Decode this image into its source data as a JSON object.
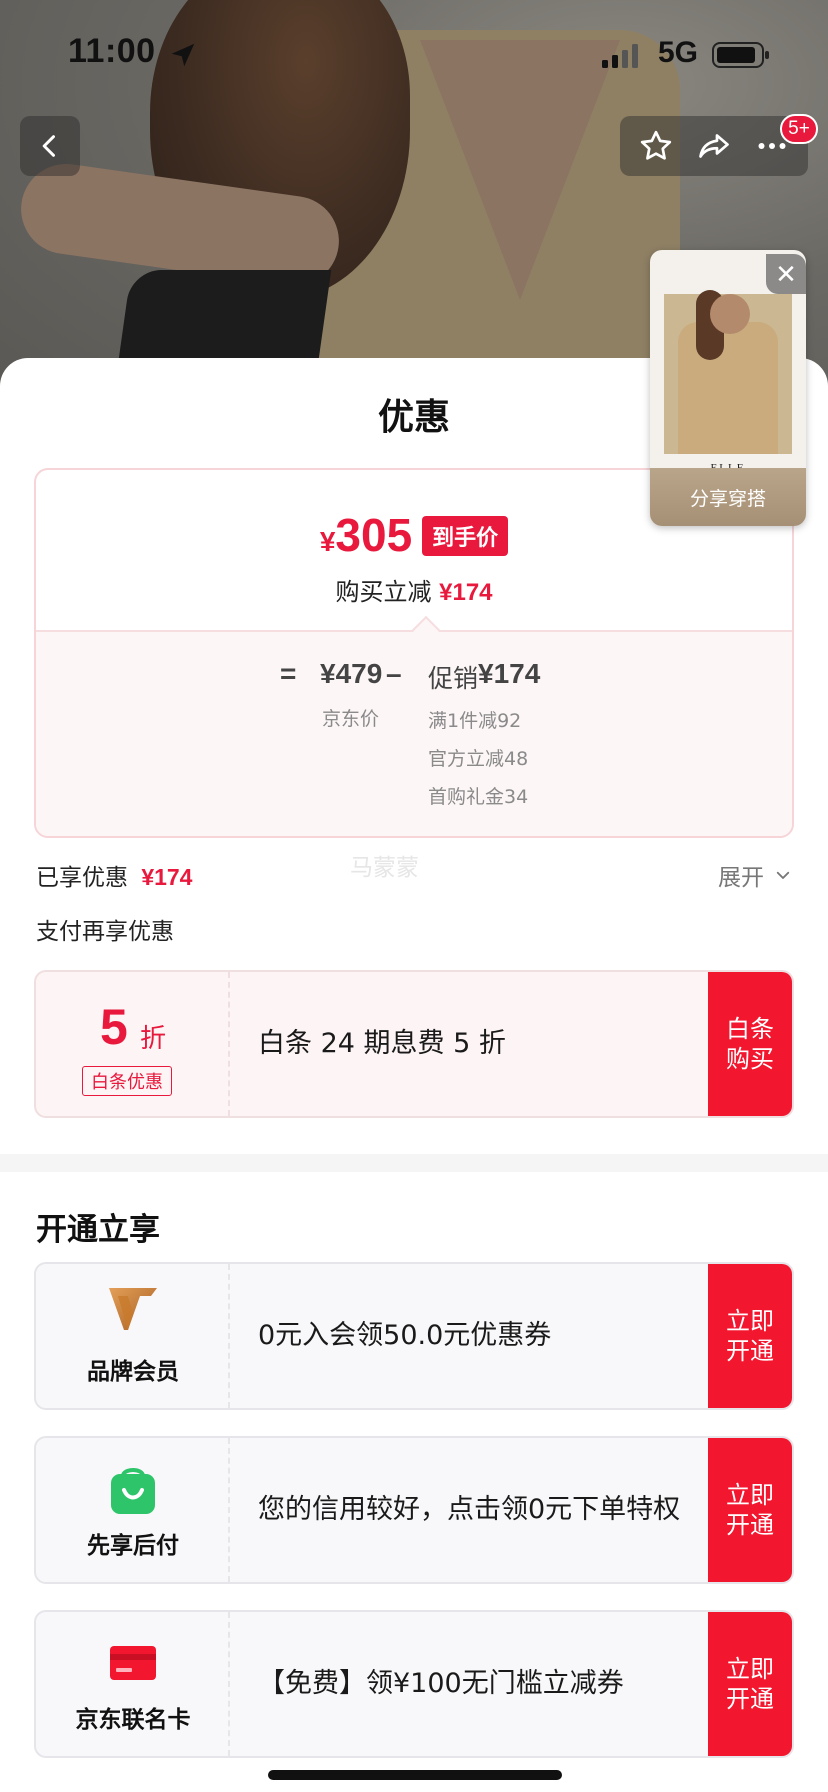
{
  "status_bar": {
    "time": "11:00",
    "network": "5G",
    "icons": [
      "location-arrow-icon",
      "signal-icon",
      "battery-icon"
    ]
  },
  "nav": {
    "back_icon": "chevron-left-icon",
    "action_icons": [
      "star-icon",
      "share-icon",
      "more-icon"
    ],
    "badge": "5+"
  },
  "sheet": {
    "title": "优惠"
  },
  "price_card": {
    "currency": "¥",
    "final_price": "305",
    "final_tag": "到手价",
    "reduce_label": "购买立减",
    "reduce_value": "¥174",
    "formula_eq": "=",
    "jd_price": "¥479",
    "minus": "–",
    "promo_label": "促销",
    "promo_value": "¥174",
    "jd_price_label": "京东价",
    "promo_items": [
      "满1件减92",
      "官方立减48",
      "首购礼金34"
    ]
  },
  "share_look": {
    "brand": "ELLE",
    "caption": "分享穿搭",
    "close_symbol": "✕"
  },
  "enjoyed": {
    "label": "已享优惠",
    "value": "¥174",
    "expand": "展开",
    "watermark": "马蒙蒙"
  },
  "pay_section": {
    "title": "支付再享优惠"
  },
  "baitiao": {
    "discount": "5",
    "unit": "折",
    "tag": "白条优惠",
    "text": "白条 24 期息费 5 折",
    "cta": "白条购买"
  },
  "open_section": {
    "title": "开通立享",
    "cards": [
      {
        "label": "品牌会员",
        "icon": "brand-member-icon",
        "text": "0元入会领50.0元优惠券",
        "cta": "立即开通"
      },
      {
        "label": "先享后付",
        "icon": "shopping-bag-icon",
        "text": "您的信用较好，点击领0元下单特权",
        "cta": "立即开通"
      },
      {
        "label": "京东联名卡",
        "icon": "credit-card-icon",
        "text": "【免费】领¥100无门槛立减券",
        "cta": "立即开通"
      }
    ]
  },
  "colors": {
    "accent": "#e8193d",
    "cta_red": "#f2162f",
    "member_gold": "#c87a2c",
    "pay_green": "#2ec46a"
  }
}
